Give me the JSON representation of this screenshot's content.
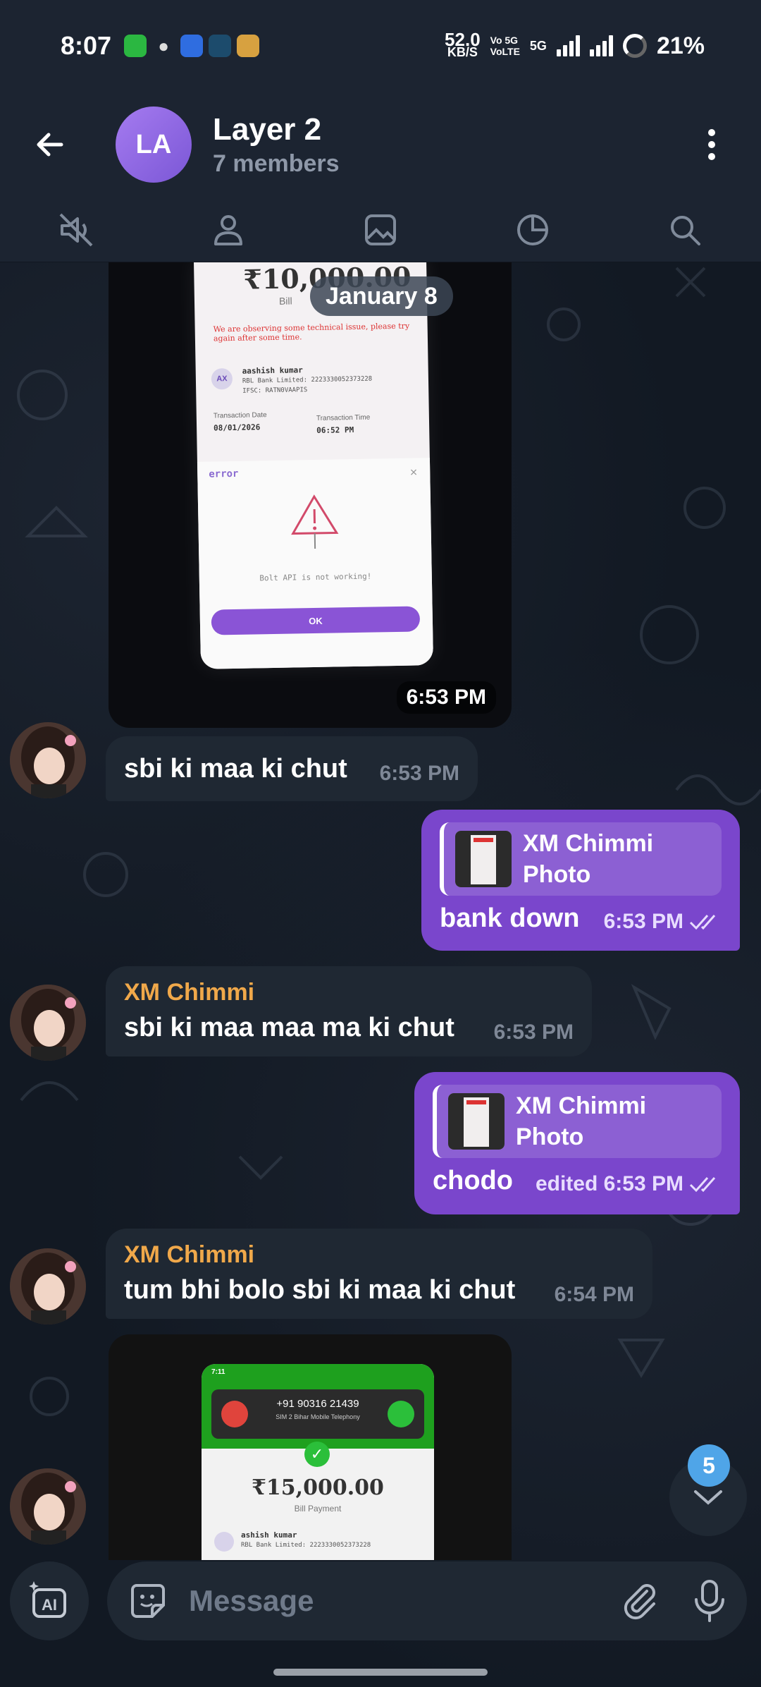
{
  "status_bar": {
    "time": "8:07",
    "net_speed_value": "52.0",
    "net_speed_unit": "KB/S",
    "volte_1": "Vo 5G",
    "volte_2": "VoLTE",
    "network": "5G",
    "battery": "21%"
  },
  "header": {
    "avatar_initials": "LA",
    "title": "Layer 2",
    "subtitle": "7 members"
  },
  "tabs": [
    "mute",
    "members",
    "media",
    "stats",
    "search"
  ],
  "date_chip": "January 8",
  "messages": {
    "photo1": {
      "time": "6:53 PM",
      "amount": "₹10,000.00",
      "bill": "Bill",
      "error_notice": "We are observing some technical issue, please try again after some time.",
      "name": "aashish kumar",
      "bank": "RBL Bank Limited: 2223330052373228",
      "ifsc": "IFSC: RATN0VAAPIS",
      "txn_date_label": "Transaction Date",
      "txn_date": "08/01/2026",
      "txn_time_label": "Transaction Time",
      "txn_time": "06:52 PM",
      "error_title": "error",
      "error_body": "Bolt API is not working!",
      "ok": "OK"
    },
    "m1": {
      "text": "sbi ki maa ki chut",
      "time": "6:53 PM"
    },
    "m2": {
      "reply_name": "XM Chimmi",
      "reply_type": "Photo",
      "text": "bank down",
      "time": "6:53 PM"
    },
    "m3": {
      "sender": "XM Chimmi",
      "text": "sbi ki maa maa ma ki chut",
      "time": "6:53 PM"
    },
    "m4": {
      "reply_name": "XM Chimmi",
      "reply_type": "Photo",
      "text": "chodo",
      "time": "edited 6:53 PM"
    },
    "m5": {
      "sender": "XM Chimmi",
      "text": "tum bhi bolo sbi ki maa ki chut",
      "time": "6:54 PM"
    },
    "photo2": {
      "phone_time": "7:11",
      "caller": "+91 90316 21439",
      "sim": "SIM 2 Bihar Mobile Telephony",
      "amount": "₹15,000.00",
      "bill": "Bill Payment",
      "name": "ashish kumar",
      "bank": "RBL Bank Limited: 2223330052373228"
    }
  },
  "scroll_badge": "5",
  "composer": {
    "placeholder": "Message",
    "ai_label": "AI"
  },
  "colors": {
    "outgoing": "#7a46cc",
    "incoming": "#1f2833",
    "sender_name": "#f0a84a",
    "badge": "#4fa5e8"
  }
}
